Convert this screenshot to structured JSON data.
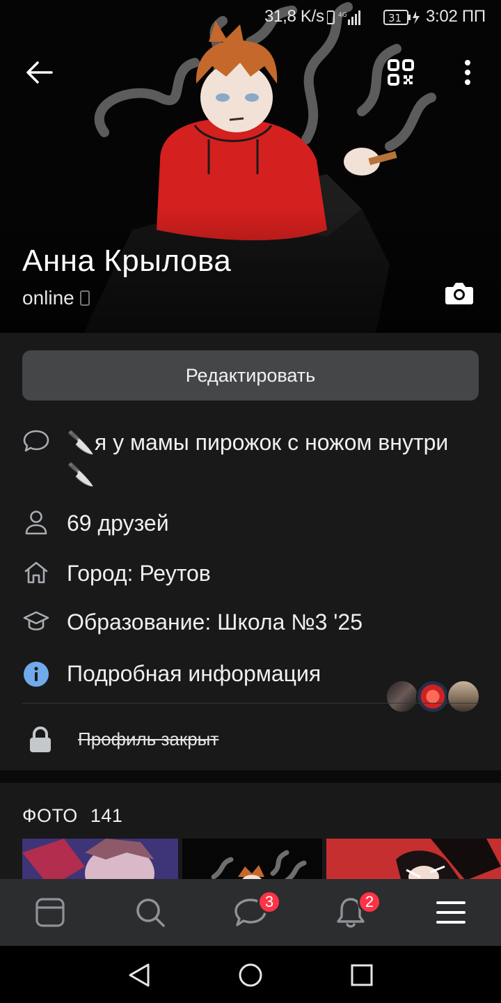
{
  "status_bar": {
    "speed": "31,8 K/s",
    "battery": "31",
    "time": "3:02 ПП"
  },
  "profile": {
    "name": "Анна Крылова",
    "status": "online"
  },
  "actions": {
    "edit_label": "Редактировать"
  },
  "info": {
    "status_text": "🔪я у мамы пирожок с ножом внутри🔪",
    "friends": "69 друзей",
    "city": "Город: Реутов",
    "education": "Образование: Школа №3 '25",
    "details": "Подробная информация",
    "private": "Профиль закрыт"
  },
  "photos": {
    "title": "ФОТО",
    "count": "141"
  },
  "tabbar": {
    "messages_badge": "3",
    "notifications_badge": "2"
  },
  "colors": {
    "background": "#19191a",
    "button": "#454647",
    "tabbar": "#2c2d2e",
    "badge": "#ff3347",
    "info_icon": "#71aaeb"
  },
  "icons": {
    "back": "arrow-left-icon",
    "qr": "qr-code-icon",
    "more": "more-vertical-icon",
    "camera": "camera-icon",
    "status": "speech-bubble-icon",
    "friends": "user-icon",
    "city": "home-icon",
    "education": "graduation-cap-icon",
    "details": "info-icon",
    "private": "lock-icon"
  }
}
